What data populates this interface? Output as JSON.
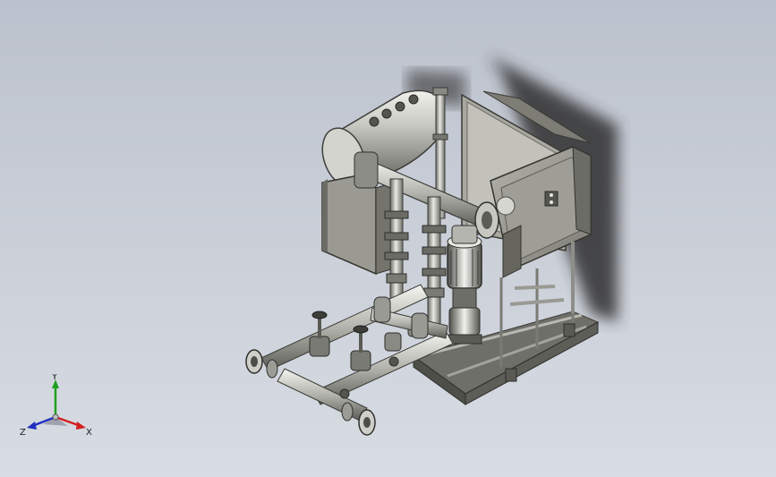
{
  "viewport": {
    "background_top": "#bcc2cd",
    "background_bottom": "#d8dce3"
  },
  "model": {
    "name": "",
    "colors": {
      "steel": "#8a8a84",
      "steel_dark": "#5a5a55",
      "steel_light": "#cfcfca",
      "panel": "#9a9a92",
      "shadow": "#3a3a3a"
    }
  },
  "triad": {
    "x_label": "X",
    "y_label": "Y",
    "z_label": "Z",
    "x_color": "#d02020",
    "y_color": "#20a020",
    "z_color": "#2030c0"
  }
}
